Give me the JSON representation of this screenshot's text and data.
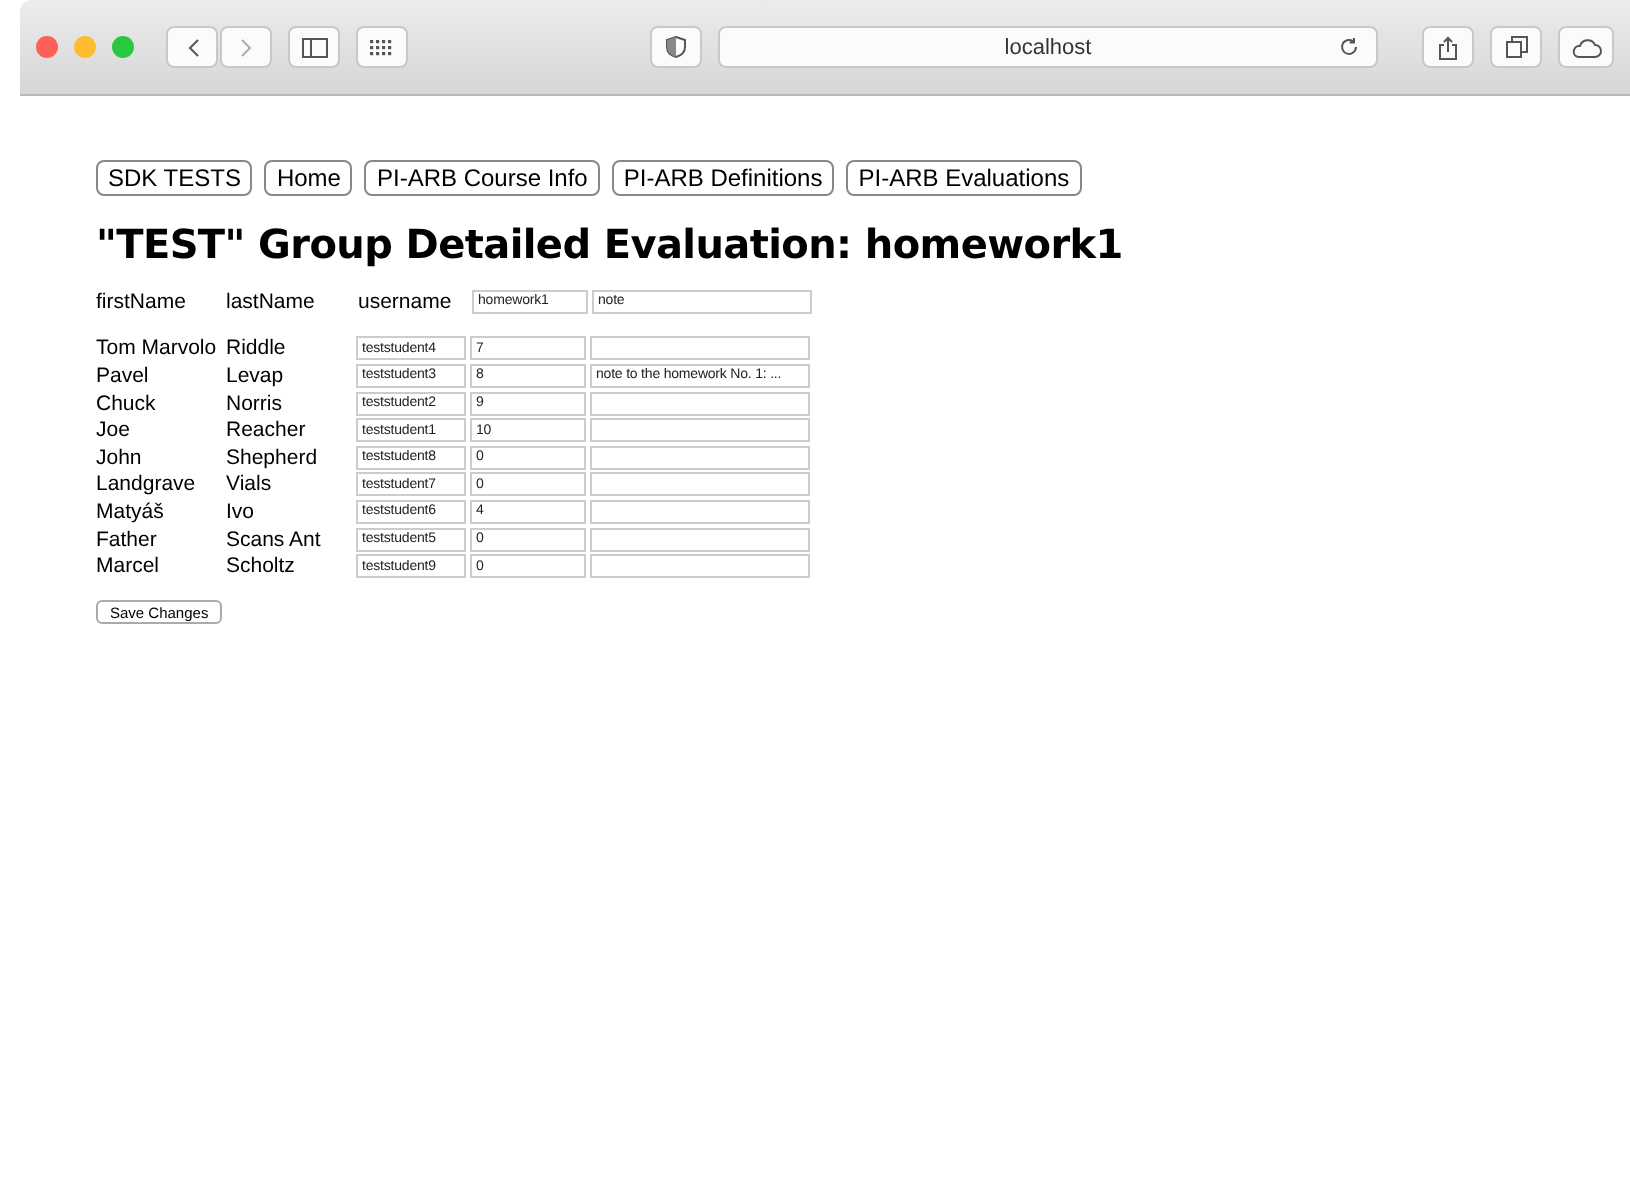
{
  "browser": {
    "address": "localhost"
  },
  "nav": [
    "SDK TESTS",
    "Home",
    "PI-ARB Course Info",
    "PI-ARB Definitions",
    "PI-ARB Evaluations"
  ],
  "title": "\"TEST\" Group Detailed Evaluation: homework1",
  "header": {
    "first": "firstName",
    "last": "lastName",
    "username": "username",
    "score_field": "homework1",
    "note_field": "note"
  },
  "rows": [
    {
      "first": "Tom Marvolo",
      "last": "Riddle",
      "username": "teststudent4",
      "score": "7",
      "note": ""
    },
    {
      "first": "Pavel",
      "last": "Levap",
      "username": "teststudent3",
      "score": "8",
      "note": "note to the homework No. 1: ..."
    },
    {
      "first": "Chuck",
      "last": "Norris",
      "username": "teststudent2",
      "score": "9",
      "note": ""
    },
    {
      "first": "Joe",
      "last": "Reacher",
      "username": "teststudent1",
      "score": "10",
      "note": ""
    },
    {
      "first": "John",
      "last": "Shepherd",
      "username": "teststudent8",
      "score": "0",
      "note": ""
    },
    {
      "first": "Landgrave",
      "last": "Vials",
      "username": "teststudent7",
      "score": "0",
      "note": ""
    },
    {
      "first": "Matyáš",
      "last": "Ivo",
      "username": "teststudent6",
      "score": "4",
      "note": ""
    },
    {
      "first": "Father",
      "last": "Scans Ant",
      "username": "teststudent5",
      "score": "0",
      "note": ""
    },
    {
      "first": "Marcel",
      "last": "Scholtz",
      "username": "teststudent9",
      "score": "0",
      "note": ""
    }
  ],
  "save": "Save Changes"
}
